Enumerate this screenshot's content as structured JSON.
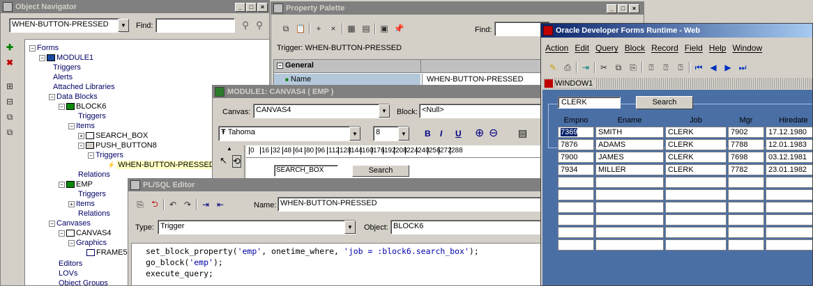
{
  "navigator": {
    "title": "Object Navigator",
    "trigger_combo": "WHEN-BUTTON-PRESSED",
    "find_label": "Find:",
    "tree": {
      "forms": "Forms",
      "module": "MODULE1",
      "triggers": "Triggers",
      "alerts": "Alerts",
      "attached_libraries": "Attached Libraries",
      "data_blocks": "Data Blocks",
      "block6": "BLOCK6",
      "block6_triggers": "Triggers",
      "items": "Items",
      "search_box": "SEARCH_BOX",
      "push_button": "PUSH_BUTTON8",
      "pb_triggers": "Triggers",
      "wbp": "WHEN-BUTTON-PRESSED",
      "relations": "Relations",
      "emp": "EMP",
      "emp_triggers": "Triggers",
      "emp_items": "Items",
      "emp_relations": "Relations",
      "canvases": "Canvases",
      "canvas4": "CANVAS4",
      "graphics": "Graphics",
      "frame": "FRAME5",
      "editors": "Editors",
      "lovs": "LOVs",
      "object_groups": "Object Groups"
    }
  },
  "palette": {
    "title": "Property Palette",
    "find_label": "Find:",
    "trigger_label": "Trigger: WHEN-BUTTON-PRESSED",
    "section": "General",
    "prop_name": "Name",
    "prop_value": "WHEN-BUTTON-PRESSED"
  },
  "layout_editor": {
    "title": "MODULE1: CANVAS4 ( EMP )",
    "canvas_label": "Canvas:",
    "canvas_value": "CANVAS4",
    "block_label": "Block:",
    "block_value": "<Null>",
    "font": "Tahoma",
    "size": "8",
    "bold": "B",
    "italic": "I",
    "underline": "U",
    "ruler": [
      "0",
      "16",
      "32",
      "48",
      "64",
      "80",
      "96",
      "112",
      "128",
      "144",
      "160",
      "176",
      "192",
      "208",
      "224",
      "240",
      "256",
      "272",
      "288"
    ],
    "search_box_item": "SEARCH_BOX",
    "search_button": "Search"
  },
  "plsql": {
    "title": "PL/SQL Editor",
    "name_label": "Name:",
    "name_value": "WHEN-BUTTON-PRESSED",
    "type_label": "Type:",
    "type_value": "Trigger",
    "object_label": "Object:",
    "object_value": "BLOCK6",
    "line1_a": "set_block_property(",
    "line1_s1": "'emp'",
    "line1_b": ", onetime_where, ",
    "line1_s2": "'job = :block6.search_box'",
    "line1_c": ");",
    "line2_a": "go_block(",
    "line2_s": "'emp'",
    "line2_b": ");",
    "line3": "execute_query;"
  },
  "runtime": {
    "title": "Oracle Developer Forms Runtime - Web",
    "menu": [
      "Action",
      "Edit",
      "Query",
      "Block",
      "Record",
      "Field",
      "Help",
      "Window"
    ],
    "window_title": "WINDOW1",
    "search_value": "CLERK",
    "search_button": "Search",
    "columns": [
      "Empno",
      "Ename",
      "Job",
      "Mgr",
      "Hiredate"
    ],
    "rows": [
      [
        "7369",
        "SMITH",
        "CLERK",
        "7902",
        "17.12.1980"
      ],
      [
        "7876",
        "ADAMS",
        "CLERK",
        "7788",
        "12.01.1983"
      ],
      [
        "7900",
        "JAMES",
        "CLERK",
        "7698",
        "03.12.1981"
      ],
      [
        "7934",
        "MILLER",
        "CLERK",
        "7782",
        "23.01.1982"
      ]
    ],
    "accent": "#0a246a",
    "canvas_bg": "#4a6fa5"
  }
}
